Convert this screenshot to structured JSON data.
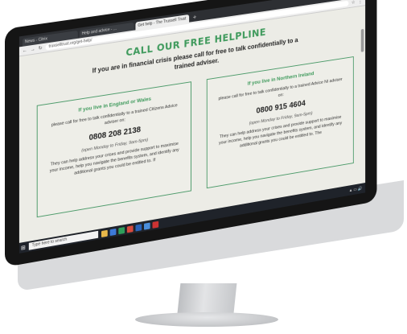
{
  "browser": {
    "tabs": [
      {
        "label": "News - Citrix"
      },
      {
        "label": "Help and advice - ..."
      },
      {
        "label": "Get help - The Trussell Trust"
      }
    ],
    "new_tab": "+",
    "url": "trusselltrust.org/get-help/"
  },
  "page": {
    "title": "CALL OUR FREE HELPLINE",
    "subtitle": "If you are in financial crisis please call for free to talk confidentially to a trained adviser.",
    "cards": [
      {
        "heading": "If you live in England or Wales",
        "intro": "please call for free to talk confidentially to a trained Citizens Advice adviser on:",
        "number": "0808 208 2138",
        "hours": "(open Monday to Friday, 9am-5pm)",
        "body": "They can help address your crises and provide support to maximise your income, help you navigate the benefits system, and identify any additional grants you could be entitled to. If"
      },
      {
        "heading": "If you live in Northern Ireland",
        "intro": "please call for free to talk confidentially to a trained Advice NI adviser on:",
        "number": "0800 915 4604",
        "hours": "(open Monday to Friday, 9am-5pm)",
        "body": "They can help address your crises and provide support to maximise your income, help you navigate the benefits system, and identify any additional grants you could be entitled to. The"
      }
    ]
  },
  "taskbar": {
    "search_placeholder": "Type here to search",
    "icon_colors": [
      "#e8b84a",
      "#3d7ad8",
      "#2f9e5a",
      "#d84a3d",
      "#2a63b8",
      "#4a8edb",
      "#c33"
    ]
  }
}
